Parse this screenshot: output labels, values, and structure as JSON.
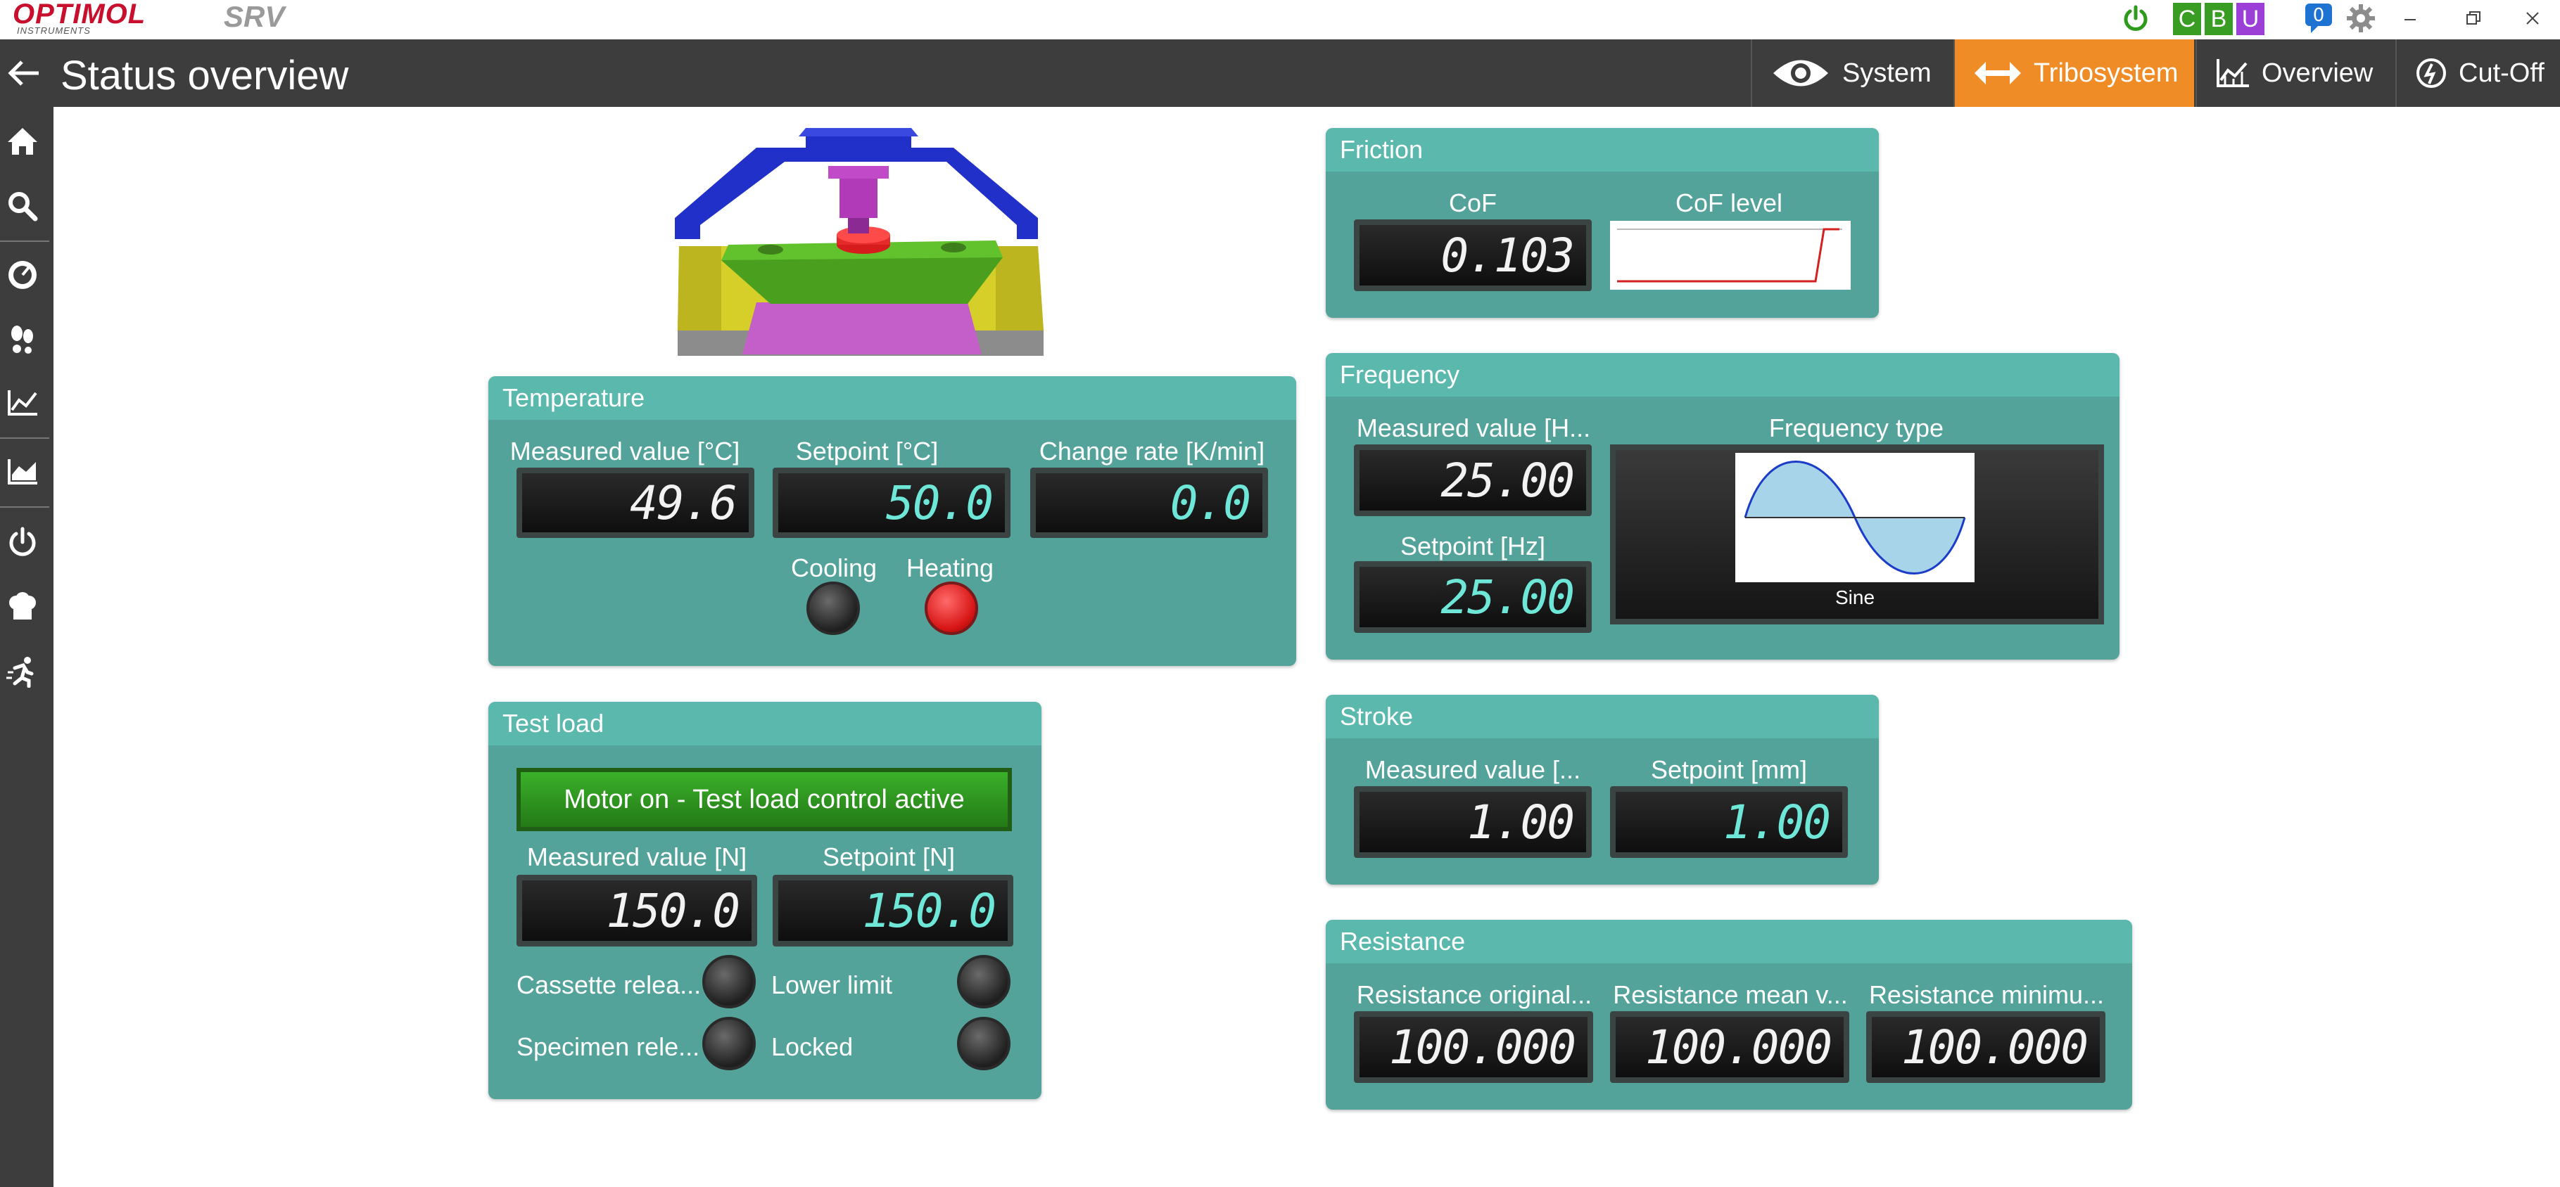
{
  "titlebar": {
    "logo": "OPTIMOL",
    "logo_sub": "INSTRUMENTS",
    "app_logo": "SRV",
    "badges": [
      {
        "letter": "C",
        "color": "#3a9d23"
      },
      {
        "letter": "B",
        "color": "#3a9d23"
      },
      {
        "letter": "U",
        "color": "#9b3fd6"
      }
    ],
    "notification_count": "0"
  },
  "header": {
    "title": "Status overview",
    "tabs": [
      {
        "label": "System",
        "icon": "eye-icon",
        "active": false
      },
      {
        "label": "Tribosystem",
        "icon": "double-arrow-icon",
        "active": true
      },
      {
        "label": "Overview",
        "icon": "chart-icon",
        "active": false
      },
      {
        "label": "Cut-Off",
        "icon": "cutoff-icon",
        "active": false
      }
    ]
  },
  "sidebar": {
    "items": [
      "home-icon",
      "search-icon",
      "gauge-icon",
      "footprints-icon",
      "line-chart-icon",
      "area-chart-icon",
      "power-icon",
      "chef-hat-icon",
      "emergency-exit-icon"
    ]
  },
  "temperature": {
    "title": "Temperature",
    "measured_label": "Measured value [°C]",
    "measured_value": "49.6",
    "setpoint_label": "Setpoint [°C]",
    "setpoint_value": "50.0",
    "rate_label": "Change rate [K/min]",
    "rate_value": "0.0",
    "cooling_label": "Cooling",
    "heating_label": "Heating"
  },
  "test_load": {
    "title": "Test load",
    "motor_button": "Motor on - Test load control active",
    "measured_label": "Measured value [N]",
    "measured_value": "150.0",
    "setpoint_label": "Setpoint [N]",
    "setpoint_value": "150.0",
    "cassette_label": "Cassette relea...",
    "lower_limit_label": "Lower limit",
    "specimen_label": "Specimen rele...",
    "locked_label": "Locked"
  },
  "friction": {
    "title": "Friction",
    "cof_label": "CoF",
    "cof_value": "0.103",
    "level_label": "CoF level"
  },
  "frequency": {
    "title": "Frequency",
    "measured_label": "Measured value [H...",
    "measured_value": "25.00",
    "setpoint_label": "Setpoint  [Hz]",
    "setpoint_value": "25.00",
    "type_label": "Frequency type",
    "type_value": "Sine"
  },
  "stroke": {
    "title": "Stroke",
    "measured_label": "Measured value [...",
    "measured_value": "1.00",
    "setpoint_label": "Setpoint [mm]",
    "setpoint_value": "1.00"
  },
  "resistance": {
    "title": "Resistance",
    "original_label": "Resistance original...",
    "original_value": "100.000",
    "mean_label": "Resistance mean v...",
    "mean_value": "100.000",
    "minimum_label": "Resistance minimu...",
    "minimum_value": "100.000"
  }
}
